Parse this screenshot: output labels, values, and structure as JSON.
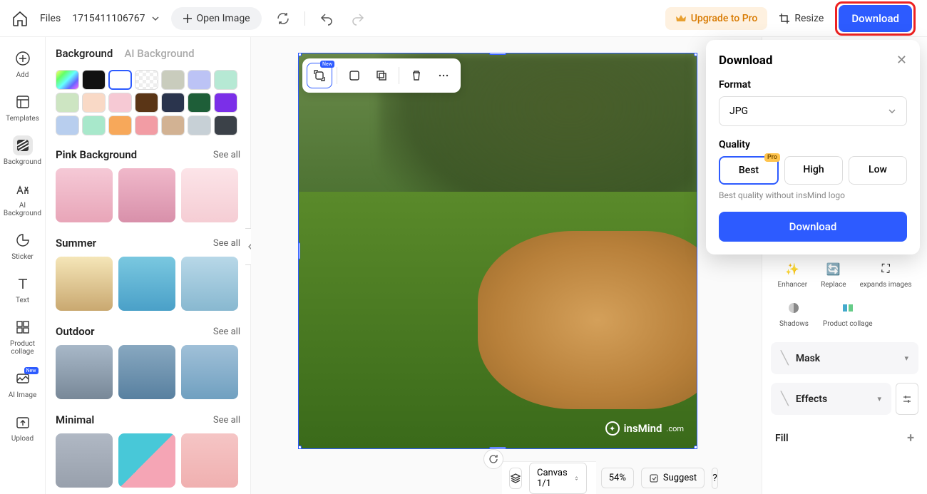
{
  "topbar": {
    "files": "Files",
    "project_name": "1715411106767",
    "open_image": "Open Image",
    "upgrade": "Upgrade to Pro",
    "resize": "Resize",
    "download": "Download"
  },
  "leftnav": {
    "add": "Add",
    "templates": "Templates",
    "background": "Background",
    "ai_background": "AI Background",
    "sticker": "Sticker",
    "text": "Text",
    "product_collage": "Product collage",
    "ai_image": "AI Image",
    "upload": "Upload",
    "new_badge": "New"
  },
  "leftpanel": {
    "tab_background": "Background",
    "tab_ai": "AI Background",
    "swatches": [
      "linear-gradient(135deg,#ff6,#6f6,#6ff,#66f,#f6f)",
      "#111",
      "#fff",
      "repeating-conic-gradient(#eee 0 25%,#fff 0 50%) 0/10px 10px",
      "#c9ccbd",
      "#bcc3f5",
      "#b6e9d4",
      "#cde5c2",
      "#f9d9c6",
      "#f6c9d4",
      "#5a3516",
      "#2a344d",
      "#1e5e38",
      "#7b2fe8",
      "#b8ceee",
      "#a8e8cb",
      "#f7a85a",
      "#f29ca4",
      "#d2b293",
      "#c7d0d6",
      "#3b4148"
    ],
    "selected_swatch_index": 2,
    "see_all": "See all",
    "cat_pink": "Pink Background",
    "cat_summer": "Summer",
    "cat_outdoor": "Outdoor",
    "cat_minimal": "Minimal"
  },
  "float_toolbar": {
    "new_badge": "New"
  },
  "watermark": {
    "brand": "insMind",
    "suffix": ".com"
  },
  "bottombar": {
    "canvas": "Canvas 1/1",
    "zoom": "54%",
    "suggest": "Suggest",
    "help": "?"
  },
  "rightpanel": {
    "enhancer": "Enhancer",
    "replace": "Replace",
    "expands": "expands images",
    "shadows": "Shadows",
    "product_collage": "Product collage",
    "mask": "Mask",
    "effects": "Effects",
    "fill": "Fill"
  },
  "download_popover": {
    "title": "Download",
    "format_label": "Format",
    "format_value": "JPG",
    "quality_label": "Quality",
    "q_best": "Best",
    "q_high": "High",
    "q_low": "Low",
    "pro": "Pro",
    "note": "Best quality without insMind logo",
    "action": "Download"
  }
}
